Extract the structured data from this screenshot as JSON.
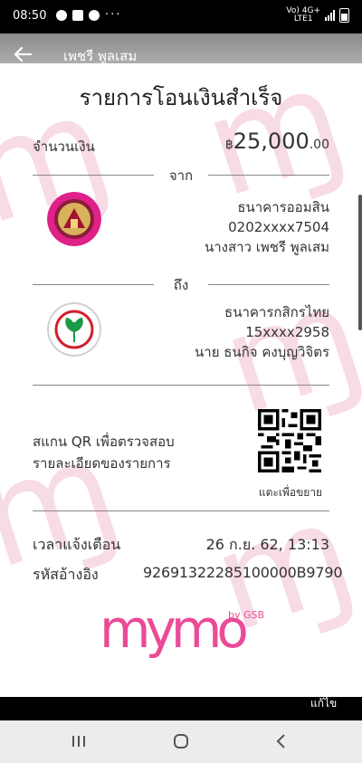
{
  "status": {
    "time": "08:50",
    "network": "Vo) 4G+\nLTE1",
    "overflow": "···"
  },
  "appbar": {
    "title": "เพชรี พูลเสม"
  },
  "receipt": {
    "heading": "รายการโอนเงินสำเร็จ",
    "amount_label": "จำนวนเงิน",
    "amount_currency": "฿",
    "amount_main": "25,000",
    "amount_decimal": ".00",
    "from_label": "จาก",
    "to_label": "ถึง",
    "from": {
      "bank": "ธนาคารออมสิน",
      "account": "0202xxxx7504",
      "name": "นางสาว เพชรี พูลเสม"
    },
    "to": {
      "bank": "ธนาคารกสิกรไทย",
      "account": "15xxxx2958",
      "name": "นาย ธนกิจ คงบุญวิจิตร"
    },
    "qr_line1": "สแกน QR เพื่อตรวจสอบ",
    "qr_line2": "รายละเอียดของรายการ",
    "qr_caption": "แตะเพื่อขยาย",
    "time_label": "เวลาแจ้งเตือน",
    "time_value": "26 ก.ย. 62, 13:13",
    "ref_label": "รหัสอ้างอิง",
    "ref_value": "92691322285100000B9790",
    "brand_text": "mymo",
    "brand_suffix": "by GSB"
  },
  "actions": {
    "edit_label": "แก้ไข"
  },
  "colors": {
    "gsb_pink": "#e0218a",
    "kbank_green": "#1b9a47",
    "brand_pink": "#ec4a97"
  }
}
